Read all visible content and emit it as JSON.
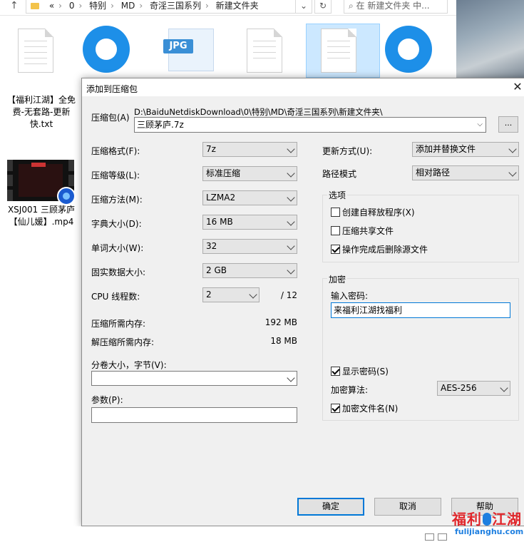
{
  "explorer": {
    "breadcrumb": [
      "«",
      "0",
      "特别",
      "MD",
      "奇淫三国系列",
      "新建文件夹"
    ],
    "search_placeholder": "在 新建文件夹 中...",
    "files": [
      {
        "label": "【福利江湖】全免费-无套路-更新快.txt"
      },
      {
        "label": "XSJ001 三顾茅庐【仙儿媛】.mp4"
      }
    ],
    "jpg_tag": "JPG"
  },
  "dialog": {
    "title": "添加到压缩包",
    "archive_label": "压缩包(A)",
    "archive_path": "D:\\BaiduNetdiskDownload\\0\\特别\\MD\\奇淫三国系列\\新建文件夹\\",
    "archive_name": "三顾茅庐.7z",
    "browse_label": "...",
    "left": {
      "format_label": "压缩格式(F):",
      "format_value": "7z",
      "level_label": "压缩等级(L):",
      "level_value": "标准压缩",
      "method_label": "压缩方法(M):",
      "method_value": "LZMA2",
      "dict_label": "字典大小(D):",
      "dict_value": "16 MB",
      "word_label": "单词大小(W):",
      "word_value": "32",
      "solid_label": "固实数据大小:",
      "solid_value": "2 GB",
      "threads_label": "CPU 线程数:",
      "threads_value": "2",
      "threads_total": "/ 12",
      "mem_comp_label": "压缩所需内存:",
      "mem_comp_value": "192 MB",
      "mem_decomp_label": "解压缩所需内存:",
      "mem_decomp_value": "18 MB",
      "volume_label": "分卷大小，字节(V):",
      "params_label": "参数(P):"
    },
    "right": {
      "update_label": "更新方式(U):",
      "update_value": "添加并替换文件",
      "path_label": "路径模式",
      "path_value": "相对路径",
      "options_title": "选项",
      "opt_sfx": "创建自释放程序(X)",
      "opt_shared": "压缩共享文件",
      "opt_delete": "操作完成后删除源文件",
      "enc_title": "加密",
      "password_label": "输入密码:",
      "password_value": "来福利江湖找福利",
      "show_password": "显示密码(S)",
      "enc_method_label": "加密算法:",
      "enc_method_value": "AES-256",
      "enc_names": "加密文件名(N)"
    },
    "buttons": {
      "ok": "确定",
      "cancel": "取消",
      "help": "帮助"
    }
  },
  "watermark": {
    "cn_a": "福利",
    "cn_b": "江湖",
    "en": "fulijianghu.com"
  }
}
